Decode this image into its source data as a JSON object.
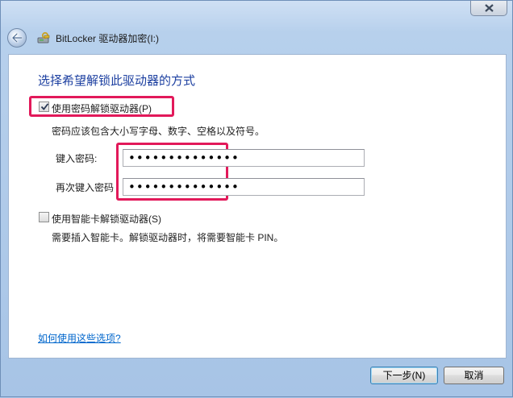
{
  "window": {
    "title": "BitLocker 驱动器加密(I:)"
  },
  "main": {
    "heading": "选择希望解锁此驱动器的方式",
    "password_option": {
      "label": "使用密码解锁驱动器(P)",
      "checked": true,
      "hint": "密码应该包含大小写字母、数字、空格以及符号。",
      "password_label": "键入密码:",
      "password_value": "••••••••••••••",
      "confirm_label": "再次键入密码",
      "confirm_value": "••••••••••••••"
    },
    "smartcard_option": {
      "label": "使用智能卡解锁驱动器(S)",
      "checked": false,
      "hint": "需要插入智能卡。解锁驱动器时，将需要智能卡 PIN。"
    },
    "help_link": "如何使用这些选项?"
  },
  "footer": {
    "next_label": "下一步(N)",
    "cancel_label": "取消"
  },
  "colors": {
    "heading": "#1c3fa0",
    "highlight": "#e2195a",
    "link": "#0066cc"
  }
}
